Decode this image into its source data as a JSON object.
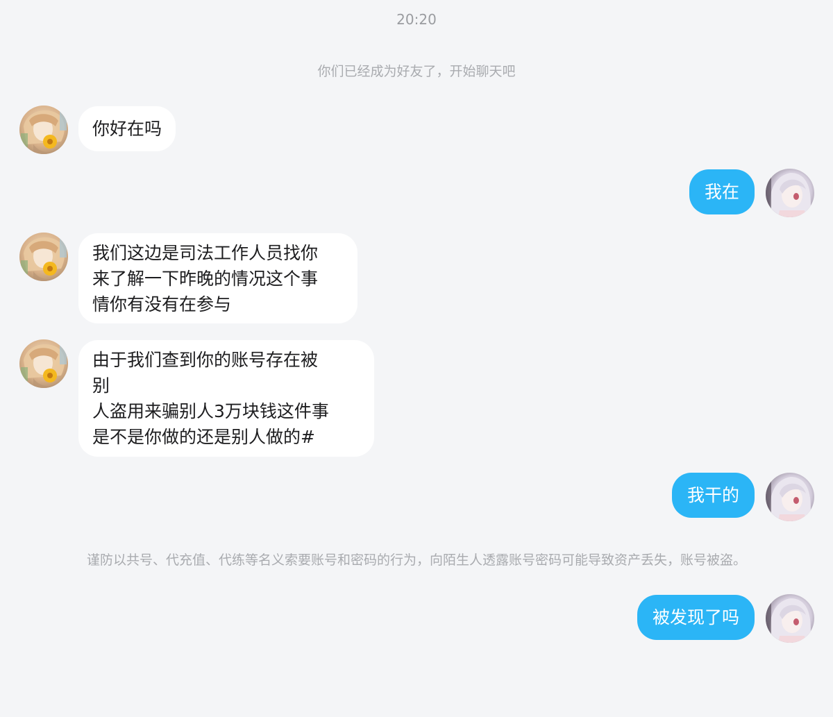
{
  "chat": {
    "time": "20:20",
    "friend_note": "你们已经成为好友了，开始聊天吧",
    "warning": "谨防以共号、代充值、代练等名义索要账号和密码的行为，向陌生人透露账号密码可能导致资产丢失，账号被盗。",
    "messages": [
      {
        "side": "left",
        "lines": [
          "你好在吗"
        ]
      },
      {
        "side": "right",
        "lines": [
          "我在"
        ]
      },
      {
        "side": "left",
        "lines": [
          "我们这边是司法工作人员找你",
          "来了解一下昨晚的情况这个事",
          "情你有没有在参与"
        ]
      },
      {
        "side": "left",
        "lines": [
          "由于我们查到你的账号存在被",
          "别",
          "人盗用来骗别人3万块钱这件事",
          "是不是你做的还是别人做的#"
        ]
      },
      {
        "side": "right",
        "lines": [
          "我干的"
        ]
      },
      {
        "side": "right",
        "lines": [
          "被发现了吗"
        ]
      }
    ]
  },
  "colors": {
    "background": "#f4f5f7",
    "incoming_bubble": "#ffffff",
    "outgoing_bubble": "#2bb5f6",
    "system_text": "#a9abaf"
  },
  "icons": {
    "incoming_avatar": "anime-girl-sunflower-avatar",
    "outgoing_avatar": "anime-white-hair-girl-avatar"
  }
}
